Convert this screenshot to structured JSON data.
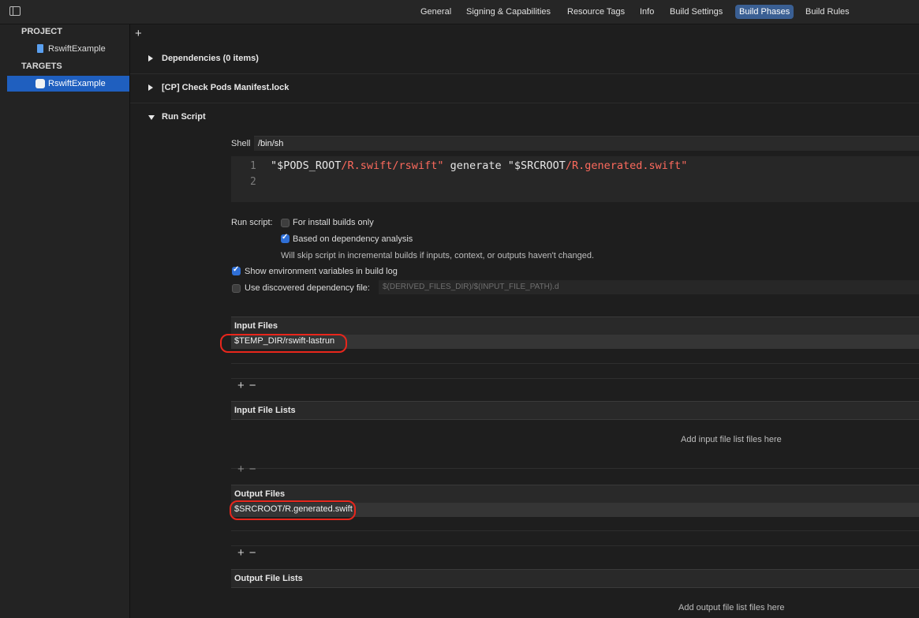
{
  "tabs": [
    {
      "label": "General",
      "active": false
    },
    {
      "label": "Signing & Capabilities",
      "active": false
    },
    {
      "label": "Resource Tags",
      "active": false
    },
    {
      "label": "Info",
      "active": false
    },
    {
      "label": "Build Settings",
      "active": false
    },
    {
      "label": "Build Phases",
      "active": true
    },
    {
      "label": "Build Rules",
      "active": false
    }
  ],
  "sidebar": {
    "project_header": "PROJECT",
    "project_item": "RswiftExample",
    "targets_header": "TARGETS",
    "target_item": "RswiftExample"
  },
  "phases": {
    "add_symbol": "+",
    "dependencies": "Dependencies (0 items)",
    "check_pods": "[CP] Check Pods Manifest.lock",
    "run_script": "Run Script"
  },
  "run_script": {
    "shell_label": "Shell",
    "shell_value": "/bin/sh",
    "line_numbers": [
      "1",
      "2"
    ],
    "code_tokens": [
      {
        "text": "\"$PODS_ROOT",
        "cls": "c-plain"
      },
      {
        "text": "/R.swift/rswift\"",
        "cls": "c-str"
      },
      {
        "text": " generate ",
        "cls": "c-plain"
      },
      {
        "text": "\"$SRCROOT",
        "cls": "c-plain"
      },
      {
        "text": "/R.generated.swift\"",
        "cls": "c-str"
      }
    ],
    "run_script_label": "Run script:",
    "install_builds_label": "For install builds only",
    "install_builds_checked": false,
    "dependency_analysis_label": "Based on dependency analysis",
    "dependency_analysis_checked": true,
    "skip_hint": "Will skip script in incremental builds if inputs, context, or outputs haven't changed.",
    "show_env_label": "Show environment variables in build log",
    "show_env_checked": true,
    "discovered_dep_label": "Use discovered dependency file:",
    "discovered_dep_checked": false,
    "discovered_dep_placeholder": "$(DERIVED_FILES_DIR)/$(INPUT_FILE_PATH).d"
  },
  "input_files": {
    "header": "Input Files",
    "items": [
      "$TEMP_DIR/rswift-lastrun"
    ]
  },
  "input_file_lists": {
    "header": "Input File Lists",
    "empty_message": "Add input file list files here"
  },
  "output_files": {
    "header": "Output Files",
    "items": [
      "$SRCROOT/R.generated.swift"
    ]
  },
  "output_file_lists": {
    "header": "Output File Lists",
    "empty_message": "Add output file list files here"
  },
  "list_controls": {
    "add": "+",
    "remove": "−"
  },
  "colors": {
    "accent": "#3a5f93",
    "selection": "#1f5fbf",
    "highlight_ring": "#e8261c",
    "string": "#fc6a5d"
  }
}
